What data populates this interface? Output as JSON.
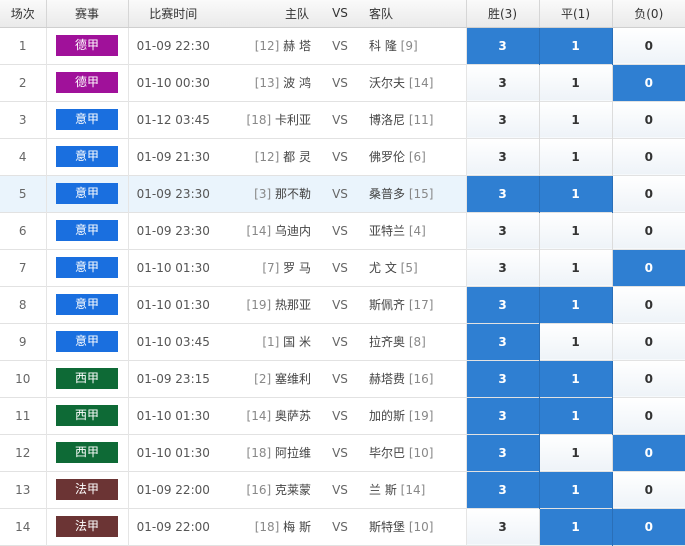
{
  "headers": {
    "num": "场次",
    "league": "赛事",
    "time": "比赛时间",
    "home": "主队",
    "vs": "VS",
    "away": "客队",
    "win": "胜(3)",
    "draw": "平(1)",
    "lose": "负(0)"
  },
  "colors": {
    "德甲": "#a0119a",
    "意甲": "#1a6fdf",
    "西甲": "#0e6a36",
    "法甲": "#6b3434",
    "selected": "#2f7fd2"
  },
  "rows": [
    {
      "num": "1",
      "league": "德甲",
      "time": "01-09 22:30",
      "home_rank": "[12]",
      "home": "赫 塔",
      "vs": "VS",
      "away": "科 隆",
      "away_rank": "[9]",
      "win": "3",
      "draw": "1",
      "lose": "0",
      "selected": [
        "win",
        "draw"
      ],
      "highlight": false
    },
    {
      "num": "2",
      "league": "德甲",
      "time": "01-10 00:30",
      "home_rank": "[13]",
      "home": "波 鸿",
      "vs": "VS",
      "away": "沃尔夫",
      "away_rank": "[14]",
      "win": "3",
      "draw": "1",
      "lose": "0",
      "selected": [
        "lose"
      ],
      "highlight": false
    },
    {
      "num": "3",
      "league": "意甲",
      "time": "01-12 03:45",
      "home_rank": "[18]",
      "home": "卡利亚",
      "vs": "VS",
      "away": "博洛尼",
      "away_rank": "[11]",
      "win": "3",
      "draw": "1",
      "lose": "0",
      "selected": [],
      "highlight": false
    },
    {
      "num": "4",
      "league": "意甲",
      "time": "01-09 21:30",
      "home_rank": "[12]",
      "home": "都 灵",
      "vs": "VS",
      "away": "佛罗伦",
      "away_rank": "[6]",
      "win": "3",
      "draw": "1",
      "lose": "0",
      "selected": [],
      "highlight": false
    },
    {
      "num": "5",
      "league": "意甲",
      "time": "01-09 23:30",
      "home_rank": "[3]",
      "home": "那不勒",
      "vs": "VS",
      "away": "桑普多",
      "away_rank": "[15]",
      "win": "3",
      "draw": "1",
      "lose": "0",
      "selected": [
        "win",
        "draw"
      ],
      "highlight": true
    },
    {
      "num": "6",
      "league": "意甲",
      "time": "01-09 23:30",
      "home_rank": "[14]",
      "home": "乌迪内",
      "vs": "VS",
      "away": "亚特兰",
      "away_rank": "[4]",
      "win": "3",
      "draw": "1",
      "lose": "0",
      "selected": [],
      "highlight": false
    },
    {
      "num": "7",
      "league": "意甲",
      "time": "01-10 01:30",
      "home_rank": "[7]",
      "home": "罗 马",
      "vs": "VS",
      "away": "尤 文",
      "away_rank": "[5]",
      "win": "3",
      "draw": "1",
      "lose": "0",
      "selected": [
        "lose"
      ],
      "highlight": false
    },
    {
      "num": "8",
      "league": "意甲",
      "time": "01-10 01:30",
      "home_rank": "[19]",
      "home": "热那亚",
      "vs": "VS",
      "away": "斯佩齐",
      "away_rank": "[17]",
      "win": "3",
      "draw": "1",
      "lose": "0",
      "selected": [
        "win",
        "draw"
      ],
      "highlight": false
    },
    {
      "num": "9",
      "league": "意甲",
      "time": "01-10 03:45",
      "home_rank": "[1]",
      "home": "国 米",
      "vs": "VS",
      "away": "拉齐奥",
      "away_rank": "[8]",
      "win": "3",
      "draw": "1",
      "lose": "0",
      "selected": [
        "win"
      ],
      "highlight": false
    },
    {
      "num": "10",
      "league": "西甲",
      "time": "01-09 23:15",
      "home_rank": "[2]",
      "home": "塞维利",
      "vs": "VS",
      "away": "赫塔费",
      "away_rank": "[16]",
      "win": "3",
      "draw": "1",
      "lose": "0",
      "selected": [
        "win",
        "draw"
      ],
      "highlight": false
    },
    {
      "num": "11",
      "league": "西甲",
      "time": "01-10 01:30",
      "home_rank": "[14]",
      "home": "奥萨苏",
      "vs": "VS",
      "away": "加的斯",
      "away_rank": "[19]",
      "win": "3",
      "draw": "1",
      "lose": "0",
      "selected": [
        "win",
        "draw"
      ],
      "highlight": false
    },
    {
      "num": "12",
      "league": "西甲",
      "time": "01-10 01:30",
      "home_rank": "[18]",
      "home": "阿拉维",
      "vs": "VS",
      "away": "毕尔巴",
      "away_rank": "[10]",
      "win": "3",
      "draw": "1",
      "lose": "0",
      "selected": [
        "win",
        "lose"
      ],
      "highlight": false
    },
    {
      "num": "13",
      "league": "法甲",
      "time": "01-09 22:00",
      "home_rank": "[16]",
      "home": "克莱蒙",
      "vs": "VS",
      "away": "兰 斯",
      "away_rank": "[14]",
      "win": "3",
      "draw": "1",
      "lose": "0",
      "selected": [
        "win",
        "draw"
      ],
      "highlight": false
    },
    {
      "num": "14",
      "league": "法甲",
      "time": "01-09 22:00",
      "home_rank": "[18]",
      "home": "梅 斯",
      "vs": "VS",
      "away": "斯特堡",
      "away_rank": "[10]",
      "win": "3",
      "draw": "1",
      "lose": "0",
      "selected": [
        "draw",
        "lose"
      ],
      "highlight": false
    }
  ]
}
